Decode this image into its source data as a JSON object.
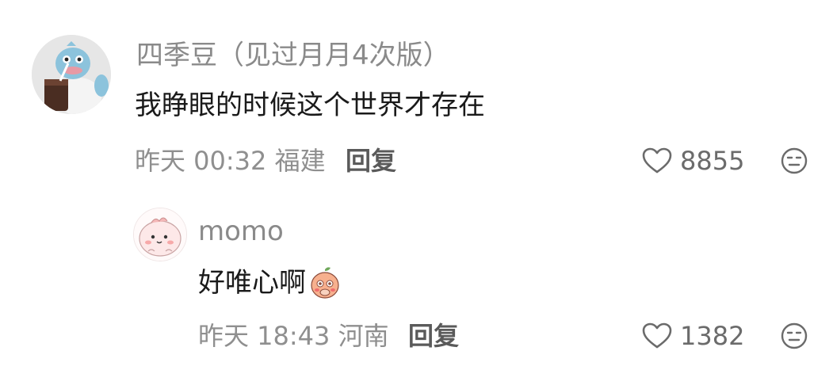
{
  "comments": [
    {
      "username": "四季豆（见过月月4次版）",
      "text": "我睁眼的时候这个世界才存在",
      "time": "昨天 00:32",
      "location": "福建",
      "reply_label": "回复",
      "likes": "8855",
      "avatar_icon": "shark-holding-coffee-avatar"
    },
    {
      "username": "momo",
      "text": "好唯心啊",
      "emoji_icon": "blushing-peach-emoji",
      "time": "昨天 18:43",
      "location": "河南",
      "reply_label": "回复",
      "likes": "1382",
      "avatar_icon": "pink-cartoon-avatar"
    }
  ],
  "icons": {
    "like": "heart-outline-icon",
    "dislike": "unamused-face-icon"
  },
  "colors": {
    "meta_text": "#8f8f8f",
    "content_text": "#1a1a1a",
    "reply_text": "#5a5a5a"
  }
}
